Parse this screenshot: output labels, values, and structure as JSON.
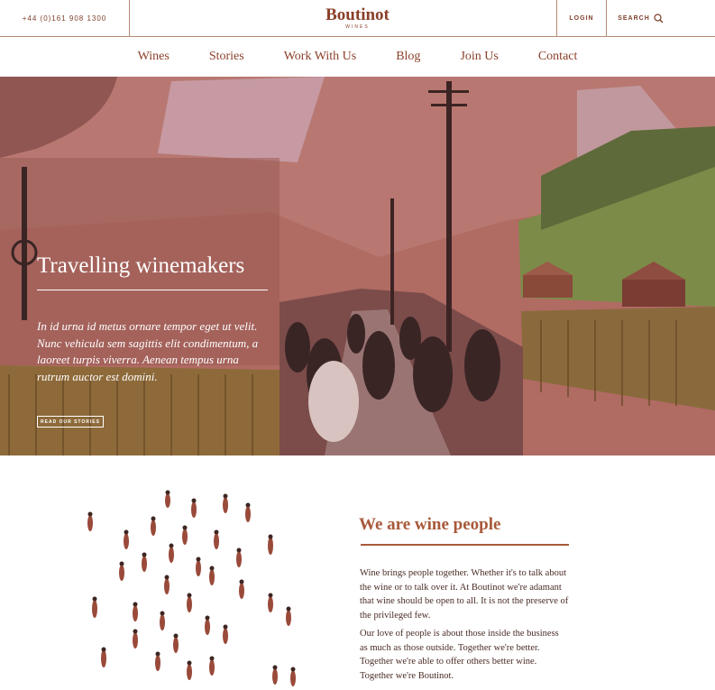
{
  "header": {
    "phone": "+44 (0)161 908 1300",
    "logo_main": "Boutinot",
    "logo_sub": "WINES",
    "login": "LOGIN",
    "search": "SEARCH"
  },
  "nav": {
    "items": [
      "Wines",
      "Stories",
      "Work With Us",
      "Blog",
      "Join Us",
      "Contact"
    ]
  },
  "hero": {
    "title": "Travelling winemakers",
    "body": "In id urna id metus ornare tempor eget ut velit. Nunc vehicula sem sagittis elit condimentum, a laoreet turpis viverra. Aenean tempus urna rutrum auctor est domini.",
    "button": "READ OUR STORIES"
  },
  "section": {
    "title": "We are wine people",
    "para1": "Wine brings people together. Whether it's to talk about the wine or to talk over it. At Boutinot we're adamant that wine should be open to all. It is not the preserve of the privileged few.",
    "para2": "Our love of people is about those inside the business as much as those outside. Together we're better. Together we're able to offer others better wine. Together we're Boutinot."
  },
  "colors": {
    "brand": "#8a3f28",
    "accent": "#a8593a",
    "hero_tint": "#a6645c"
  },
  "icons": {
    "search": "search-icon"
  }
}
